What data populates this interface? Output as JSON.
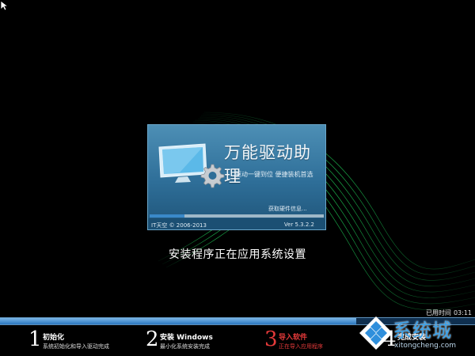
{
  "splash": {
    "title": "万能驱动助理",
    "subtitle": "驱动一键到位 便捷装机首选",
    "status": "获取硬件信息...",
    "progress": 0.2,
    "footer_left": "IT天空 © 2006-2013",
    "footer_right": "Ver 5.3.2.2"
  },
  "status_message": "安装程序正在应用系统设置",
  "elapsed": {
    "label": "已用时间",
    "value": "03:11"
  },
  "main_progress": 0.75,
  "steps": [
    {
      "num": "1",
      "title": "初始化",
      "desc": "系统初始化和导入驱动完成"
    },
    {
      "num": "2",
      "title": "安装 Windows",
      "desc": "最小化系统安装完成"
    },
    {
      "num": "3",
      "title": "导入软件",
      "desc": "正在导入应用程序"
    },
    {
      "num": "4",
      "title": "完成安装",
      "desc": ""
    }
  ],
  "active_step": 3,
  "watermark": {
    "text": "系统城",
    "url": "xitongcheng.com"
  },
  "colors": {
    "accent_blue": "#2a76bf",
    "active_step": "#e53a3a",
    "swoosh": "#1fd35a"
  }
}
